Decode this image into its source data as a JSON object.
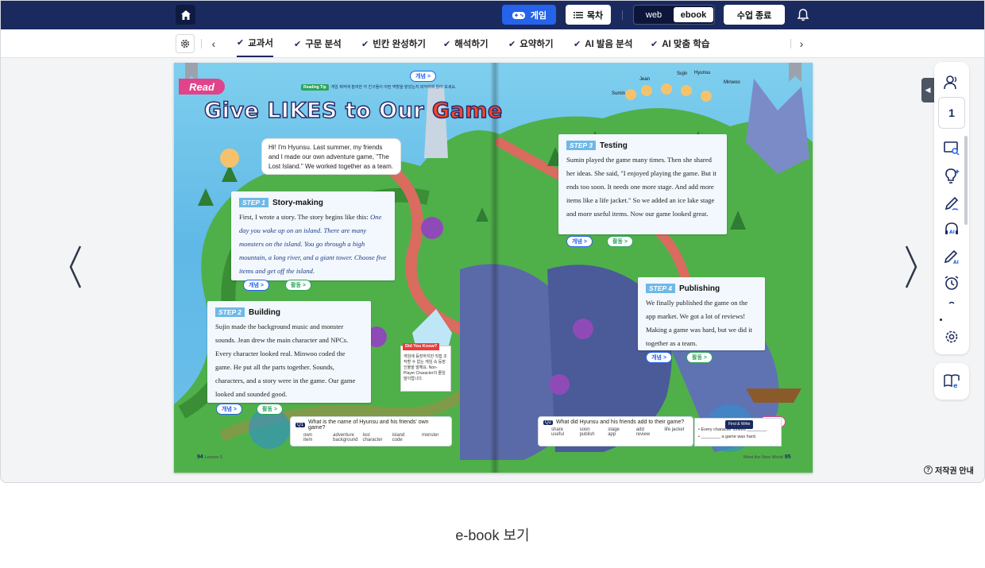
{
  "topbar": {
    "game_label": "게임",
    "toc_label": "목차",
    "view_web": "web",
    "view_ebook": "ebook",
    "end_class_label": "수업 종료"
  },
  "tabs": [
    {
      "label": "교과서",
      "active": true
    },
    {
      "label": "구문 분석"
    },
    {
      "label": "빈칸 완성하기"
    },
    {
      "label": "해석하기"
    },
    {
      "label": "요약하기"
    },
    {
      "label": "AI 발음 분석"
    },
    {
      "label": "AI 맞춤 학습"
    }
  ],
  "book": {
    "read_tag": "Read",
    "title_part1": "Give LIKES",
    "title_part2": " to Our ",
    "title_part3": "Game",
    "reading_tip_label": "Reading Tip",
    "reading_tip": "게임 제작에 참여한 각 친구들이 어떤 역할을 맡았는지 파악하며 읽어 보세요.",
    "concept_label": "개념",
    "activity_label": "활동",
    "characters": [
      "Jean",
      "Sujin",
      "Hyunsu",
      "Minwoo",
      "Sumin"
    ],
    "bubble": "Hi! I'm Hyunsu. Last summer, my friends and I made our own adventure game, \"The Lost Island.\" We worked together as a team.",
    "step1": {
      "num": "STEP 1",
      "title": "Story-making",
      "text": "First, I wrote a story. The story begins like this:",
      "italic": "One day you wake up on an island. There are many monsters on the island. You go through a high mountain, a long river, and a giant tower. Choose five items and get off the island."
    },
    "step2": {
      "num": "STEP 2",
      "title": "Building",
      "text": "Sujin made the background music and monster sounds. Jean drew the main character and NPCs. Every character looked real. Minwoo coded the game. He put all the parts together. Sounds, characters, and a story were in the game. Our game looked and sounded good."
    },
    "step3": {
      "num": "STEP 3",
      "title": "Testing",
      "text": "Sumin played the game many times. Then she shared her ideas. She said, \"I enjoyed playing the game. But it ends too soon. It needs one more stage. And add more items like a life jacket.\" So we added an ice lake stage and more useful items. Now our game looked great."
    },
    "step4": {
      "num": "STEP 4",
      "title": "Publishing",
      "text": "We finally published the game on the app market. We got a lot of reviews! Making a game was hard, but we did it together as a team."
    },
    "did_you_know_label": "Did You Know?",
    "did_you_know": "게임에 등장하지만 직접 조작할 수 없는 게임 속 등장인물을 말해요. Non-Player Character의 줄임말이랍니다.",
    "q1": {
      "num": "Q1",
      "text": "What is the name of Hyunsu and his friends' own game?",
      "words": [
        "own",
        "adventure",
        "lost",
        "island",
        "monster",
        "item",
        "background",
        "character",
        "code",
        ""
      ]
    },
    "q2": {
      "num": "Q2",
      "text": "What did Hyunsu and his friends add to their game?",
      "words": [
        "share",
        "soon",
        "stage",
        "add",
        "life jacket",
        "useful",
        "publish",
        "app",
        "review",
        ""
      ]
    },
    "find_write": {
      "label": "Find & Write",
      "line1": "• Every character looked ________.",
      "line2": "• ________ a game was hard."
    },
    "grammar_label": "문항",
    "page_left": "94",
    "page_left_label": "Lesson 5",
    "page_right": "95",
    "page_right_label": "Meet the New World"
  },
  "sidebar": {
    "page_number": "1"
  },
  "copyright_label": "저작권 안내",
  "caption": "e-book 보기",
  "colors": {
    "navy": "#1b2a5e",
    "accent_blue": "#2563eb",
    "sky": "#6ec1ea"
  }
}
